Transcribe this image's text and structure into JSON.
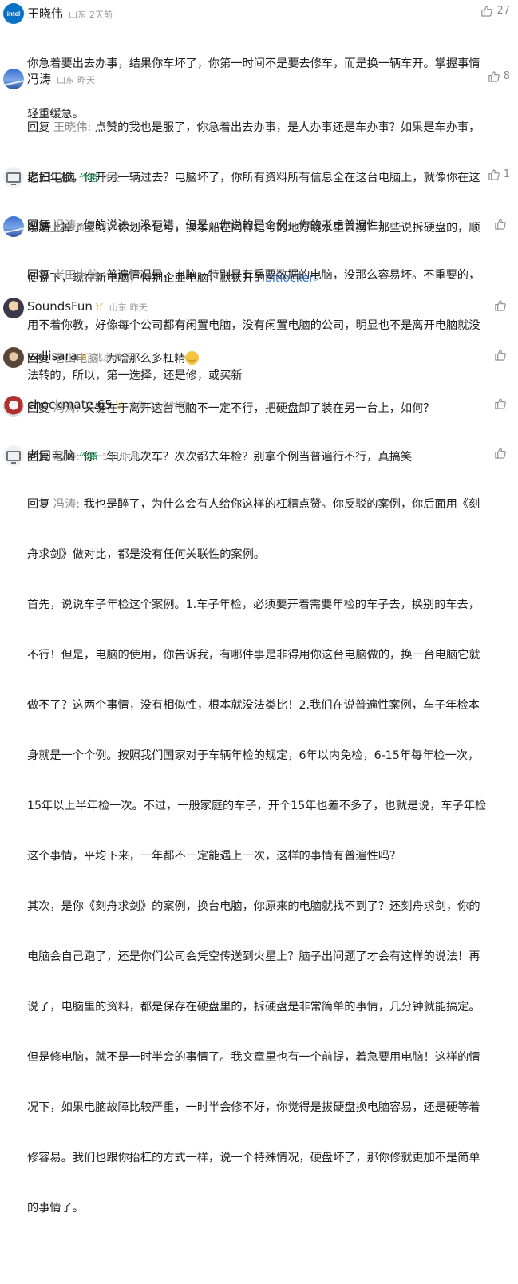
{
  "comments": [
    {
      "avatar_icon": "intel-logo-avatar",
      "avatar_text": "intel",
      "name": "王晓伟",
      "location": "山东",
      "time": "2天前",
      "likes": "27",
      "lines": [
        "你急着要出去办事，结果你车坏了，你第一时间不是要去修车，而是换一辆车开。掌握事情",
        "轻重缓急。"
      ]
    },
    {
      "avatar_icon": "sky-avatar",
      "name": "冯涛",
      "location": "山东",
      "time": "昨天",
      "likes": "8",
      "reply_label": "回复",
      "reply_to": "王晓伟:",
      "first_line": " 点赞的我也是服了，你急着出去办事，是人办事还是车办事？如果是车办事，",
      "lines": [
        "比如年检，你开另一辆过去？电脑坏了，你所有资料所有信息全在这台电脑上，就像你在这",
        "条船上掉了宝剑，你划个记号，换条船在同样记号的地方跳水里去捞？那些说拆硬盘的，顺"
      ],
      "last_prefix": "便说下，现在新电脑，特别企业电脑，默认开的",
      "link": "bitlocker"
    },
    {
      "avatar_icon": "computer-avatar",
      "name": "老田电脑",
      "author_tag": "作者",
      "time": "昨天",
      "likes": "1",
      "reply_label": "回复",
      "reply_to": "冯涛:",
      "first_line": " 你的说法，没有错，但是，你说的是个例，你的考虑普遍性！"
    },
    {
      "avatar_icon": "sky-avatar",
      "name": "冯涛",
      "location": "山东",
      "time": "昨天",
      "reply_label": "回复",
      "reply_to": "老田电脑:",
      "first_line": " 普遍情况是，电脑，特别是有重要数据的电脑，没那么容易坏。不重要的，",
      "lines": [
        "用不着你教，好像每个公司都有闲置电脑，没有闲置电脑的公司，明显也不是离开电脑就没",
        "法转的，所以，第一选择，还是修，或买新"
      ]
    },
    {
      "avatar_icon": "user-avatar",
      "name": "SoundsFun",
      "badge": "♉",
      "location": "山东",
      "time": "昨天",
      "reply_label": "回复",
      "reply_to": "老田电脑:",
      "first_line": " 为啥那么多杠精"
    },
    {
      "avatar_icon": "user-avatar",
      "name": "vallisara",
      "badge": "♉",
      "location": "北京",
      "time": "昨天",
      "reply_label": "回复",
      "reply_to": "冯涛:",
      "first_line": " 关键在于离开这台电脑不一定不行，把硬盘卸了装在另一台上，如何？"
    },
    {
      "avatar_icon": "user-avatar",
      "name": "checkmate.65",
      "badge": "♉",
      "location": "上海",
      "time": "19小时前",
      "reply_label": "回复",
      "reply_to": "冯涛:",
      "first_line": " 你一年开几次车？次次都去年检？别拿个例当普遍行不行，真搞笑"
    },
    {
      "avatar_icon": "computer-avatar",
      "name": "老田电脑",
      "author_tag": "作者",
      "time": "18小时前",
      "reply_label": "回复",
      "reply_to": "冯涛:",
      "first_line": " 我也是醉了，为什么会有人给你这样的杠精点赞。你反驳的案例，你后面用《刻",
      "lines": [
        "舟求剑》做对比，都是没有任何关联性的案例。",
        "首先，说说车子年检这个案例。1.车子年检，必须要开着需要年检的车子去，换别的车去，",
        "不行！但是，电脑的使用，你告诉我，有哪件事是非得用你这台电脑做的，换一台电脑它就",
        "做不了？这两个事情，没有相似性，根本就没法类比！2.我们在说普遍性案例，车子年检本",
        "身就是一个个例。按照我们国家对于车辆年检的规定，6年以内免检，6-15年每年检一次，",
        "15年以上半年检一次。不过，一般家庭的车子，开个15年也差不多了，也就是说，车子年检",
        "这个事情，平均下来，一年都不一定能遇上一次，这样的事情有普遍性吗？",
        "其次，是你《刻舟求剑》的案例，换台电脑，你原来的电脑就找不到了？还刻舟求剑，你的",
        "电脑会自己跑了，还是你们公司会凭空传送到火星上？脑子出问题了才会有这样的说法！再",
        "说了，电脑里的资料，都是保存在硬盘里的，拆硬盘是非常简单的事情，几分钟就能搞定。",
        "但是修电脑，就不是一时半会的事情了。我文章里也有一个前提，着急要用电脑！这样的情",
        "况下，如果电脑故障比较严重，一时半会修不好，你觉得是拔硬盘换电脑容易，还是硬等着",
        "修容易。我们也跟你抬杠的方式一样，说一个特殊情况，硬盘坏了，那你修就更加不是简单",
        "的事情了。"
      ]
    }
  ]
}
